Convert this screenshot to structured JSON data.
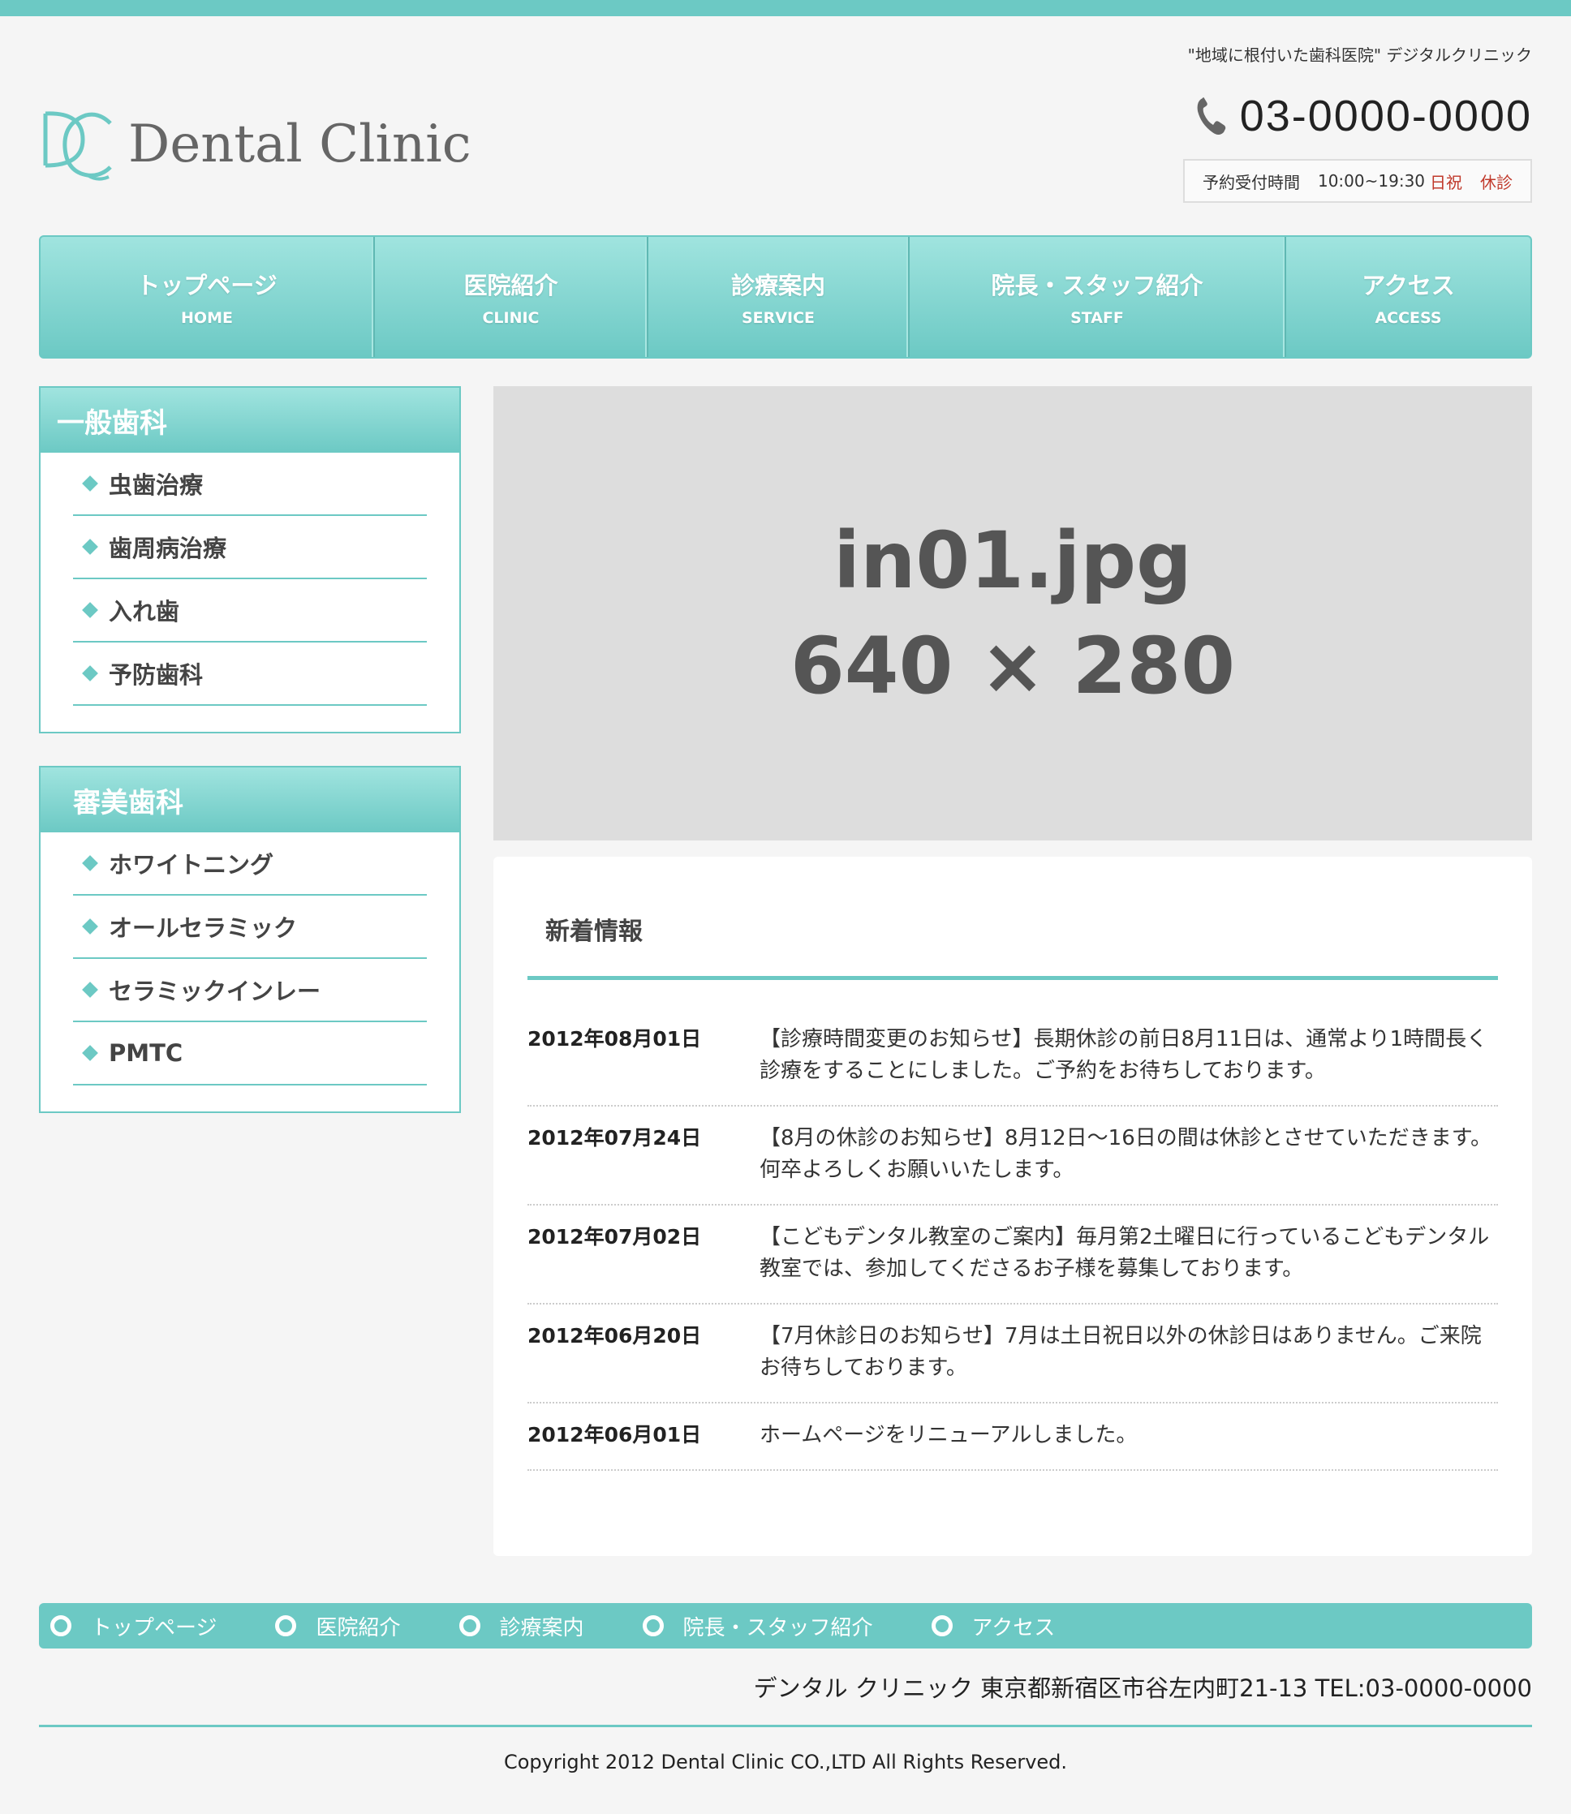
{
  "header": {
    "logo_text": "Dental Clinic",
    "tagline": "\"地域に根付いた歯科医院\" デジタルクリニック",
    "phone": "03-0000-0000",
    "hours_label": "予約受付時間",
    "hours_time": "10:00~19:30",
    "hours_holiday": "日祝",
    "hours_closed": "休診"
  },
  "nav": [
    {
      "jp": "トップページ",
      "en": "HOME"
    },
    {
      "jp": "医院紹介",
      "en": "CLINIC"
    },
    {
      "jp": "診療案内",
      "en": "SERVICE"
    },
    {
      "jp": "院長・スタッフ紹介",
      "en": "STAFF"
    },
    {
      "jp": "アクセス",
      "en": "ACCESS"
    }
  ],
  "sidebar": {
    "general": {
      "title": "一般歯科",
      "items": [
        "虫歯治療",
        "歯周病治療",
        "入れ歯",
        "予防歯科"
      ]
    },
    "cosmetic": {
      "title": "審美歯科",
      "items": [
        "ホワイトニング",
        "オールセラミック",
        "セラミックインレー",
        "PMTC"
      ]
    }
  },
  "hero": {
    "line1": "in01.jpg",
    "line2": "640 × 280"
  },
  "news": {
    "title": "新着情報",
    "items": [
      {
        "date": "2012年08月01日",
        "text": "【診療時間変更のお知らせ】長期休診の前日8月11日は、通常より1時間長く診療をすることにしました。ご予約をお待ちしております。"
      },
      {
        "date": "2012年07月24日",
        "text": "【8月の休診のお知らせ】8月12日～16日の間は休診とさせていただきます。何卒よろしくお願いいたします。"
      },
      {
        "date": "2012年07月02日",
        "text": "【こどもデンタル教室のご案内】毎月第2土曜日に行っているこどもデンタル教室では、参加してくださるお子様を募集しております。"
      },
      {
        "date": "2012年06月20日",
        "text": "【7月休診日のお知らせ】7月は土日祝日以外の休診日はありません。ご来院お待ちしております。"
      },
      {
        "date": "2012年06月01日",
        "text": "ホームページをリニューアルしました。"
      }
    ]
  },
  "footer": {
    "nav": [
      "トップページ",
      "医院紹介",
      "診療案内",
      "院長・スタッフ紹介",
      "アクセス"
    ],
    "address": "デンタル クリニック 東京都新宿区市谷左内町21-13 TEL:03-0000-0000",
    "copyright": "Copyright 2012 Dental Clinic CO.,LTD All Rights Reserved."
  },
  "colors": {
    "accent": "#6cc9c4",
    "accent_light": "#a0e4df",
    "holiday_red": "#c0392b",
    "hero_bg": "#dddddd"
  },
  "icons": [
    "logo-dc-icon",
    "phone-icon",
    "diamond-bullet-icon",
    "circle-bullet-icon"
  ]
}
